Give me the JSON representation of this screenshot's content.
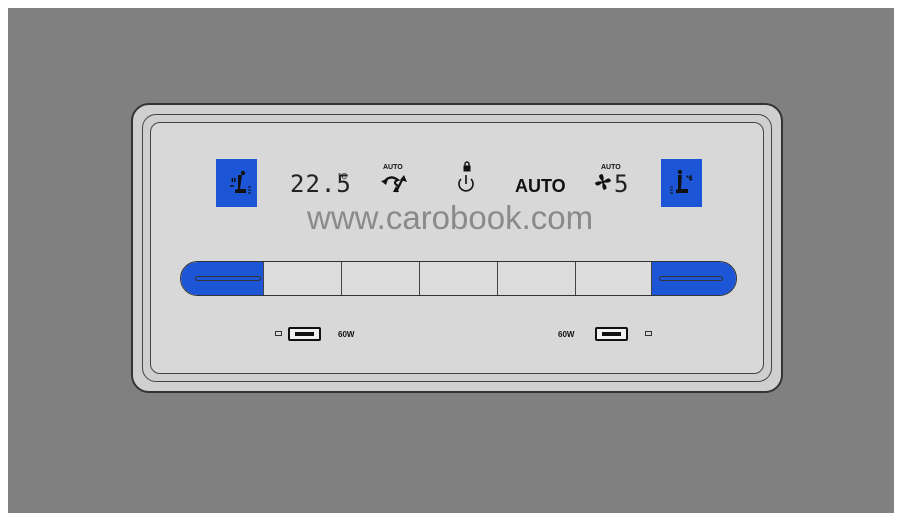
{
  "panel": {
    "temperature": "22.5",
    "temperature_unit": "°C",
    "recirc_auto_label": "AUTO",
    "mode_label": "AUTO",
    "fan_auto_label": "AUTO",
    "fan_level": "5",
    "watermark": "www.carobook.com",
    "usb_left_power": "60W",
    "usb_right_power": "60W"
  },
  "icons": {
    "left_seat": "heated-seat-icon",
    "right_seat": "ventilated-seat-icon",
    "recirc": "air-recirculation-icon",
    "power": "power-icon",
    "lock": "lock-icon",
    "fan": "fan-icon",
    "usb_left": "usb-c-port-icon",
    "usb_right": "usb-c-port-icon"
  },
  "colors": {
    "accent_blue": "#1c56d6",
    "panel_gray": "#d8d8d8",
    "background": "#808080"
  }
}
